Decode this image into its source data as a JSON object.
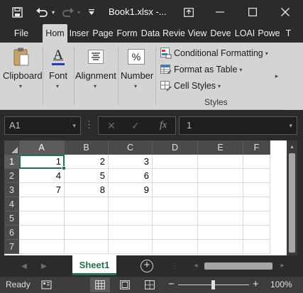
{
  "titlebar": {
    "filename": "Book1.xlsx -...",
    "icons": [
      "save-icon",
      "undo-icon",
      "undo-dropdown-icon",
      "redo-icon",
      "redo-dropdown-icon",
      "customize-quick-access-icon",
      "ribbon-display-options-icon",
      "minimize-icon",
      "maximize-icon",
      "close-icon"
    ]
  },
  "tabs": [
    {
      "label": "File"
    },
    {
      "label": "Hom",
      "active": true
    },
    {
      "label": "Inser"
    },
    {
      "label": "Page"
    },
    {
      "label": "Form"
    },
    {
      "label": "Data"
    },
    {
      "label": "Revie"
    },
    {
      "label": "View"
    },
    {
      "label": "Deve"
    },
    {
      "label": "LOAI"
    },
    {
      "label": "Powe"
    },
    {
      "label": "T"
    }
  ],
  "ribbon": {
    "clipboard": "Clipboard",
    "font": "Font",
    "alignment": "Alignment",
    "number": "Number",
    "conditional_formatting": "Conditional Formatting",
    "format_as_table": "Format as Table",
    "cell_styles": "Cell Styles",
    "styles_group": "Styles",
    "font_glyph": "A",
    "number_glyph": "%"
  },
  "formula_bar": {
    "name_box": "A1",
    "fx": "fx",
    "value": "1"
  },
  "grid": {
    "columns": [
      "A",
      "B",
      "C",
      "D",
      "E",
      "F"
    ],
    "rows": [
      "1",
      "2",
      "3",
      "4",
      "5",
      "6",
      "7"
    ],
    "cells": [
      [
        "1",
        "2",
        "3"
      ],
      [
        "4",
        "5",
        "6"
      ],
      [
        "7",
        "8",
        "9"
      ]
    ],
    "active_cell": "A1"
  },
  "sheets": {
    "tabs": [
      "Sheet1"
    ],
    "active": "Sheet1"
  },
  "status": {
    "ready": "Ready",
    "zoom": "100%",
    "zoom_minus": "−",
    "zoom_plus": "+"
  },
  "colors": {
    "accent": "#217346",
    "chrome": "#2b2b2b",
    "ribbon": "#d4d4d4"
  }
}
